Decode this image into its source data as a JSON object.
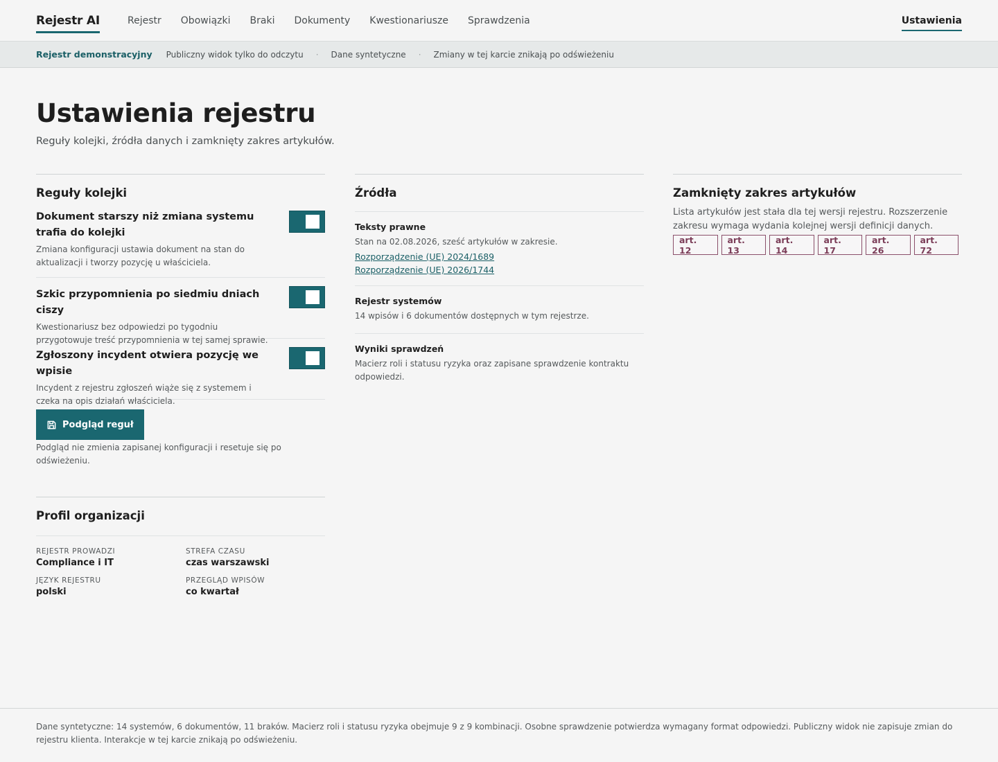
{
  "nav": {
    "brand": "Rejestr AI",
    "links": [
      "Rejestr",
      "Obowiązki",
      "Braki",
      "Dokumenty",
      "Kwestionariusze",
      "Sprawdzenia"
    ],
    "settings": "Ustawienia"
  },
  "banner": {
    "title": "Rejestr demonstracyjny",
    "items": [
      "Publiczny widok tylko do odczytu",
      "Dane syntetyczne",
      "Zmiany w tej karcie znikają po odświeżeniu"
    ],
    "separator": "·"
  },
  "page": {
    "title": "Ustawienia rejestru",
    "subtitle": "Reguły kolejki, źródła danych i zamknięty zakres artykułów."
  },
  "rules": {
    "title": "Reguły kolejki",
    "items": [
      {
        "title": "Dokument starszy niż zmiana systemu trafia do kolejki",
        "desc": "Zmiana konfiguracji ustawia dokument na stan do aktualizacji i tworzy pozycję u właściciela.",
        "enabled": true
      },
      {
        "title": "Szkic przypomnienia po siedmiu dniach ciszy",
        "desc": "Kwestionariusz bez odpowiedzi po tygodniu przygotowuje treść przypomnienia w tej samej sprawie.",
        "enabled": true
      },
      {
        "title": "Zgłoszony incydent otwiera pozycję we wpisie",
        "desc": "Incydent z rejestru zgłoszeń wiąże się z systemem i czeka na opis działań właściciela.",
        "enabled": true
      }
    ],
    "preview_button": "Podgląd reguł",
    "preview_note": "Podgląd nie zmienia zapisanej konfiguracji i resetuje się po odświeżeniu."
  },
  "profile": {
    "title": "Profil organizacji",
    "fields": [
      {
        "key": "Rejestr prowadzi",
        "value": "Compliance i IT"
      },
      {
        "key": "Strefa czasu",
        "value": "czas warszawski"
      },
      {
        "key": "Język rejestru",
        "value": "polski"
      },
      {
        "key": "Przegląd wpisów",
        "value": "co kwartał"
      }
    ]
  },
  "sources": {
    "title": "Źródła",
    "legal": {
      "title": "Teksty prawne",
      "desc": "Stan na 02.08.2026, sześć artykułów w zakresie.",
      "links": [
        "Rozporządzenie (UE) 2024/1689",
        "Rozporządzenie (UE) 2026/1744"
      ]
    },
    "registry": {
      "title": "Rejestr systemów",
      "desc": "14 wpisów i 6 dokumentów dostępnych w tym rejestrze."
    },
    "checks": {
      "title": "Wyniki sprawdzeń",
      "desc": "Macierz roli i statusu ryzyka oraz zapisane sprawdzenie kontraktu odpowiedzi."
    }
  },
  "articles": {
    "title": "Zamknięty zakres artykułów",
    "desc": "Lista artykułów jest stała dla tej wersji rejestru. Rozszerzenie zakresu wymaga wydania kolejnej wersji definicji danych.",
    "chips": [
      "art. 12",
      "art. 13",
      "art. 14",
      "art. 17",
      "art. 26",
      "art. 72"
    ]
  },
  "footer": {
    "text": "Dane syntetyczne: 14 systemów, 6 dokumentów, 11 braków. Macierz roli i statusu ryzyka obejmuje 9 z 9 kombinacji. Osobne sprawdzenie potwierdza wymagany format odpowiedzi. Publiczny widok nie zapisuje zmian do rejestru klienta. Interakcje w tej karcie znikają po odświeżeniu."
  },
  "colors": {
    "accent": "#1a6770",
    "chip": "#7b3d58",
    "background": "#f5f5f5"
  }
}
